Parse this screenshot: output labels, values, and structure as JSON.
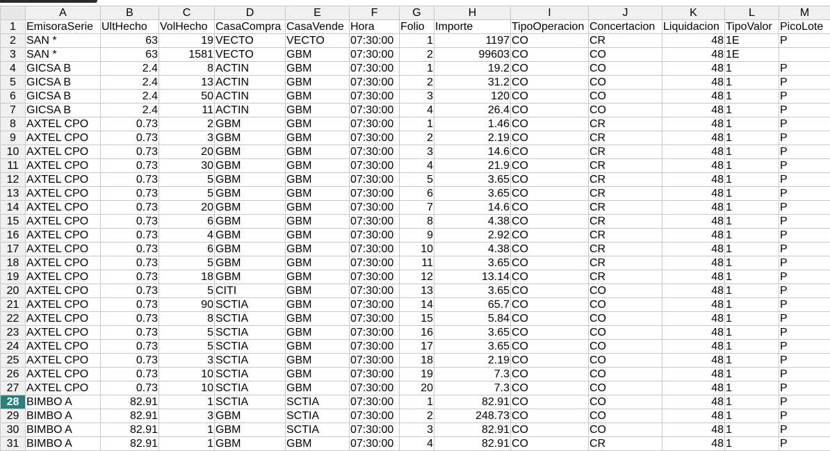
{
  "columns": [
    "A",
    "B",
    "C",
    "D",
    "E",
    "F",
    "G",
    "H",
    "I",
    "J",
    "K",
    "L",
    "M"
  ],
  "selected_row": "28",
  "rows": [
    {
      "n": "1",
      "c": [
        "EmisoraSerie",
        "UltHecho",
        "VolHecho",
        "CasaCompra",
        "CasaVende",
        "Hora",
        "Folio",
        "Importe",
        "TipoOperacion",
        "Concertacion",
        "Liquidacion",
        "TipoValor",
        "PicoLote"
      ]
    },
    {
      "n": "2",
      "c": [
        "SAN    *",
        "63",
        "19",
        "VECTO",
        "VECTO",
        "07:30:00",
        "1",
        "1197",
        "CO",
        "CR",
        "48",
        "1E",
        "P"
      ]
    },
    {
      "n": "3",
      "c": [
        "SAN    *",
        "63",
        "1581",
        "VECTO",
        "GBM",
        "07:30:00",
        "2",
        "99603",
        "CO",
        "CO",
        "48",
        "1E",
        ""
      ]
    },
    {
      "n": "4",
      "c": [
        "GICSA  B",
        "2.4",
        "8",
        "ACTIN",
        "GBM",
        "07:30:00",
        "1",
        "19.2",
        "CO",
        "CO",
        "48",
        "1",
        "P"
      ]
    },
    {
      "n": "5",
      "c": [
        "GICSA  B",
        "2.4",
        "13",
        "ACTIN",
        "GBM",
        "07:30:00",
        "2",
        "31.2",
        "CO",
        "CO",
        "48",
        "1",
        "P"
      ]
    },
    {
      "n": "6",
      "c": [
        "GICSA  B",
        "2.4",
        "50",
        "ACTIN",
        "GBM",
        "07:30:00",
        "3",
        "120",
        "CO",
        "CO",
        "48",
        "1",
        "P"
      ]
    },
    {
      "n": "7",
      "c": [
        "GICSA  B",
        "2.4",
        "11",
        "ACTIN",
        "GBM",
        "07:30:00",
        "4",
        "26.4",
        "CO",
        "CO",
        "48",
        "1",
        "P"
      ]
    },
    {
      "n": "8",
      "c": [
        "AXTEL  CPO",
        "0.73",
        "2",
        "GBM",
        "GBM",
        "07:30:00",
        "1",
        "1.46",
        "CO",
        "CR",
        "48",
        "1",
        "P"
      ]
    },
    {
      "n": "9",
      "c": [
        "AXTEL  CPO",
        "0.73",
        "3",
        "GBM",
        "GBM",
        "07:30:00",
        "2",
        "2.19",
        "CO",
        "CR",
        "48",
        "1",
        "P"
      ]
    },
    {
      "n": "10",
      "c": [
        "AXTEL  CPO",
        "0.73",
        "20",
        "GBM",
        "GBM",
        "07:30:00",
        "3",
        "14.6",
        "CO",
        "CR",
        "48",
        "1",
        "P"
      ]
    },
    {
      "n": "11",
      "c": [
        "AXTEL  CPO",
        "0.73",
        "30",
        "GBM",
        "GBM",
        "07:30:00",
        "4",
        "21.9",
        "CO",
        "CR",
        "48",
        "1",
        "P"
      ]
    },
    {
      "n": "12",
      "c": [
        "AXTEL  CPO",
        "0.73",
        "5",
        "GBM",
        "GBM",
        "07:30:00",
        "5",
        "3.65",
        "CO",
        "CR",
        "48",
        "1",
        "P"
      ]
    },
    {
      "n": "13",
      "c": [
        "AXTEL  CPO",
        "0.73",
        "5",
        "GBM",
        "GBM",
        "07:30:00",
        "6",
        "3.65",
        "CO",
        "CR",
        "48",
        "1",
        "P"
      ]
    },
    {
      "n": "14",
      "c": [
        "AXTEL  CPO",
        "0.73",
        "20",
        "GBM",
        "GBM",
        "07:30:00",
        "7",
        "14.6",
        "CO",
        "CR",
        "48",
        "1",
        "P"
      ]
    },
    {
      "n": "15",
      "c": [
        "AXTEL  CPO",
        "0.73",
        "6",
        "GBM",
        "GBM",
        "07:30:00",
        "8",
        "4.38",
        "CO",
        "CR",
        "48",
        "1",
        "P"
      ]
    },
    {
      "n": "16",
      "c": [
        "AXTEL  CPO",
        "0.73",
        "4",
        "GBM",
        "GBM",
        "07:30:00",
        "9",
        "2.92",
        "CO",
        "CR",
        "48",
        "1",
        "P"
      ]
    },
    {
      "n": "17",
      "c": [
        "AXTEL  CPO",
        "0.73",
        "6",
        "GBM",
        "GBM",
        "07:30:00",
        "10",
        "4.38",
        "CO",
        "CR",
        "48",
        "1",
        "P"
      ]
    },
    {
      "n": "18",
      "c": [
        "AXTEL  CPO",
        "0.73",
        "5",
        "GBM",
        "GBM",
        "07:30:00",
        "11",
        "3.65",
        "CO",
        "CR",
        "48",
        "1",
        "P"
      ]
    },
    {
      "n": "19",
      "c": [
        "AXTEL  CPO",
        "0.73",
        "18",
        "GBM",
        "GBM",
        "07:30:00",
        "12",
        "13.14",
        "CO",
        "CR",
        "48",
        "1",
        "P"
      ]
    },
    {
      "n": "20",
      "c": [
        "AXTEL  CPO",
        "0.73",
        "5",
        "CITI",
        "GBM",
        "07:30:00",
        "13",
        "3.65",
        "CO",
        "CO",
        "48",
        "1",
        "P"
      ]
    },
    {
      "n": "21",
      "c": [
        "AXTEL  CPO",
        "0.73",
        "90",
        "SCTIA",
        "GBM",
        "07:30:00",
        "14",
        "65.7",
        "CO",
        "CO",
        "48",
        "1",
        "P"
      ]
    },
    {
      "n": "22",
      "c": [
        "AXTEL  CPO",
        "0.73",
        "8",
        "SCTIA",
        "GBM",
        "07:30:00",
        "15",
        "5.84",
        "CO",
        "CO",
        "48",
        "1",
        "P"
      ]
    },
    {
      "n": "23",
      "c": [
        "AXTEL  CPO",
        "0.73",
        "5",
        "SCTIA",
        "GBM",
        "07:30:00",
        "16",
        "3.65",
        "CO",
        "CO",
        "48",
        "1",
        "P"
      ]
    },
    {
      "n": "24",
      "c": [
        "AXTEL  CPO",
        "0.73",
        "5",
        "SCTIA",
        "GBM",
        "07:30:00",
        "17",
        "3.65",
        "CO",
        "CO",
        "48",
        "1",
        "P"
      ]
    },
    {
      "n": "25",
      "c": [
        "AXTEL  CPO",
        "0.73",
        "3",
        "SCTIA",
        "GBM",
        "07:30:00",
        "18",
        "2.19",
        "CO",
        "CO",
        "48",
        "1",
        "P"
      ]
    },
    {
      "n": "26",
      "c": [
        "AXTEL  CPO",
        "0.73",
        "10",
        "SCTIA",
        "GBM",
        "07:30:00",
        "19",
        "7.3",
        "CO",
        "CO",
        "48",
        "1",
        "P"
      ]
    },
    {
      "n": "27",
      "c": [
        "AXTEL  CPO",
        "0.73",
        "10",
        "SCTIA",
        "GBM",
        "07:30:00",
        "20",
        "7.3",
        "CO",
        "CO",
        "48",
        "1",
        "P"
      ]
    },
    {
      "n": "28",
      "c": [
        "BIMBO  A",
        "82.91",
        "1",
        "SCTIA",
        "SCTIA",
        "07:30:00",
        "1",
        "82.91",
        "CO",
        "CO",
        "48",
        "1",
        "P"
      ]
    },
    {
      "n": "29",
      "c": [
        "BIMBO  A",
        "82.91",
        "3",
        "GBM",
        "SCTIA",
        "07:30:00",
        "2",
        "248.73",
        "CO",
        "CO",
        "48",
        "1",
        "P"
      ]
    },
    {
      "n": "30",
      "c": [
        "BIMBO  A",
        "82.91",
        "1",
        "GBM",
        "SCTIA",
        "07:30:00",
        "3",
        "82.91",
        "CO",
        "CO",
        "48",
        "1",
        "P"
      ]
    },
    {
      "n": "31",
      "c": [
        "BIMBO  A",
        "82.91",
        "1",
        "GBM",
        "GBM",
        "07:30:00",
        "4",
        "82.91",
        "CO",
        "CR",
        "48",
        "1",
        "P"
      ]
    }
  ]
}
